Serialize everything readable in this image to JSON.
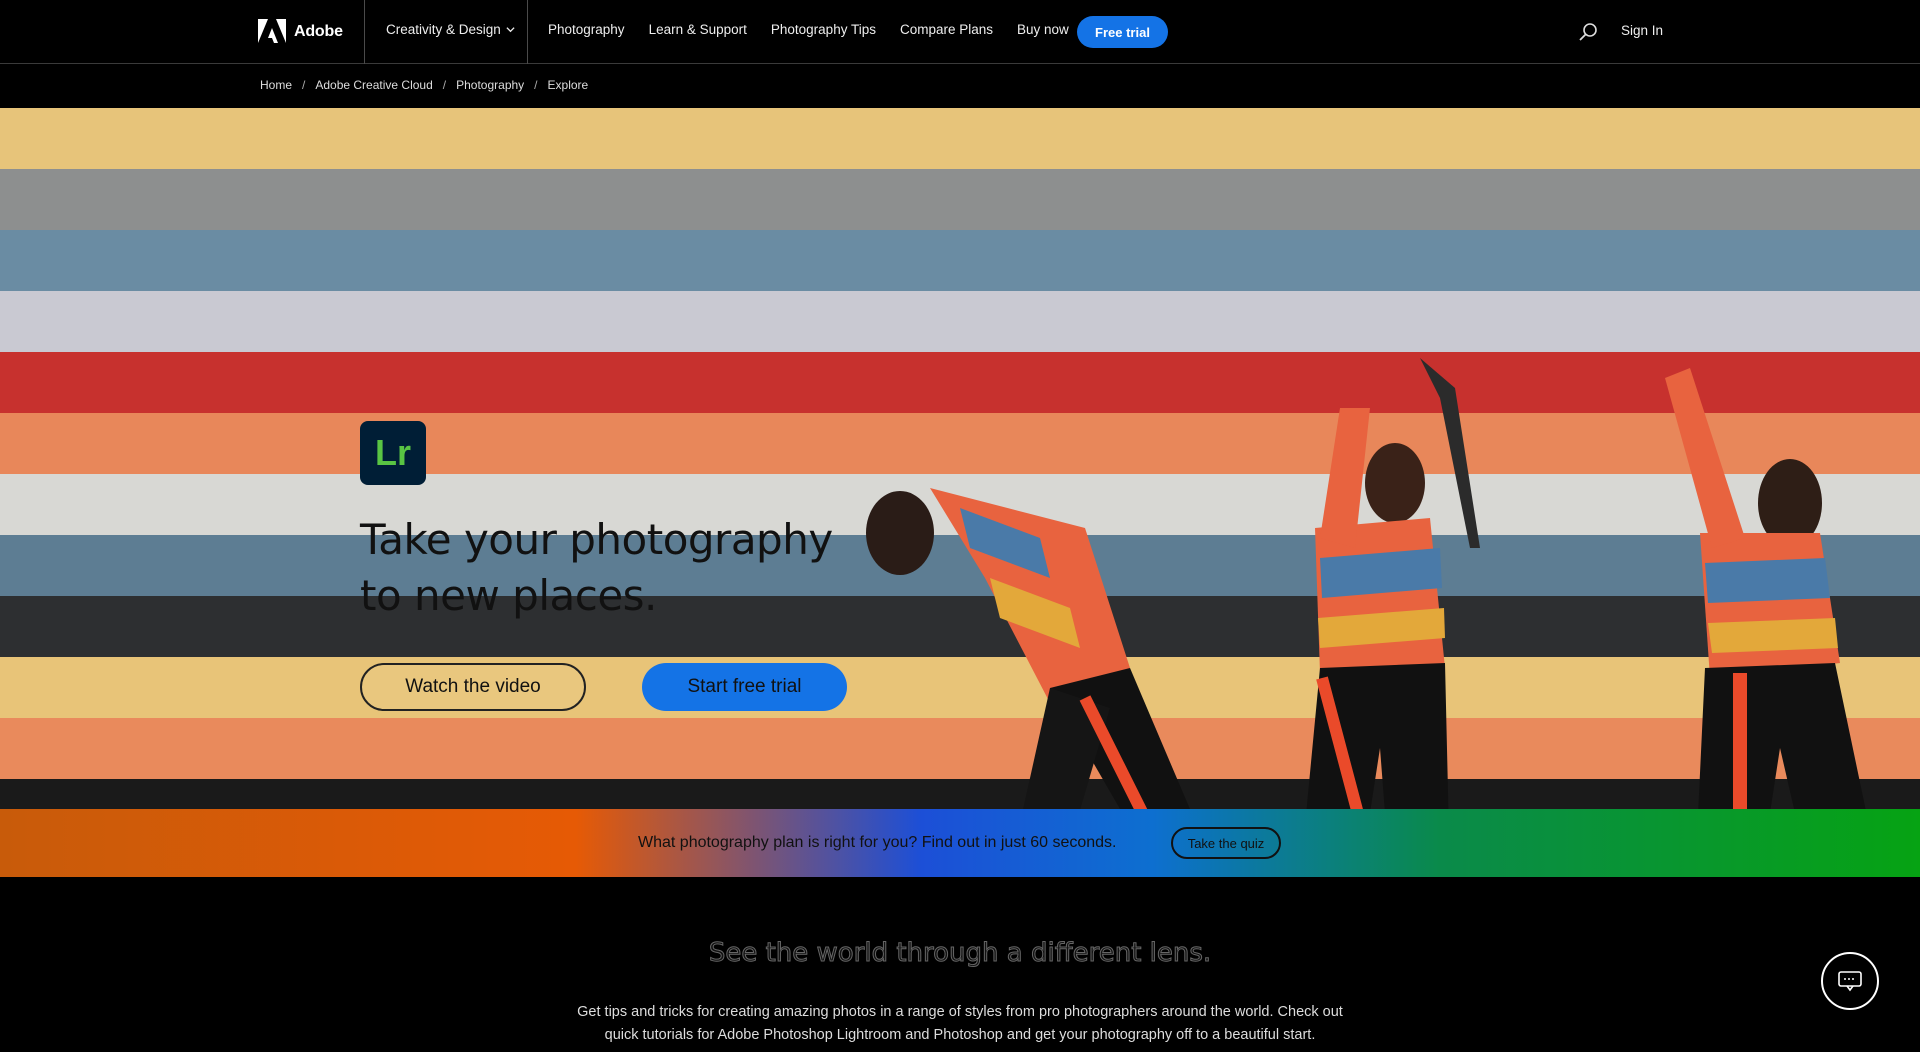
{
  "nav": {
    "brand": "Adobe",
    "dropdown": "Creativity & Design",
    "links": [
      "Photography",
      "Learn & Support",
      "Photography Tips",
      "Compare Plans",
      "Buy now"
    ],
    "cta": "Free trial",
    "sign_in": "Sign In"
  },
  "breadcrumb": [
    "Home",
    "Adobe Creative Cloud",
    "Photography",
    "Explore"
  ],
  "hero": {
    "badge_letters": "Lr",
    "title": "Take your photography to new places.",
    "watch_button": "Watch the video",
    "trial_button": "Start free trial",
    "stripe_colors": [
      "#e7c47a",
      "#8d8f8f",
      "#6a8ca3",
      "#c9c9d2",
      "#c7312e",
      "#e8875a",
      "#d8d8d4",
      "#5d7d93",
      "#2d2f31",
      "#e8c478",
      "#e98a5c",
      "#1a1a1a"
    ]
  },
  "banner": {
    "text": "What photography plan is right for you? Find out in just 60 seconds.",
    "button": "Take the quiz"
  },
  "section": {
    "title": "See the world through a different lens.",
    "description": "Get tips and tricks for creating amazing photos in a range of styles from pro photographers around the world. Check out quick tutorials for Adobe Photoshop Lightroom and Photoshop      and get your photography off to a beautiful start."
  },
  "icons": {
    "brand": "adobe-logo-icon",
    "dropdown": "chevron-down-icon",
    "search": "search-icon",
    "chat": "chat-icon"
  }
}
